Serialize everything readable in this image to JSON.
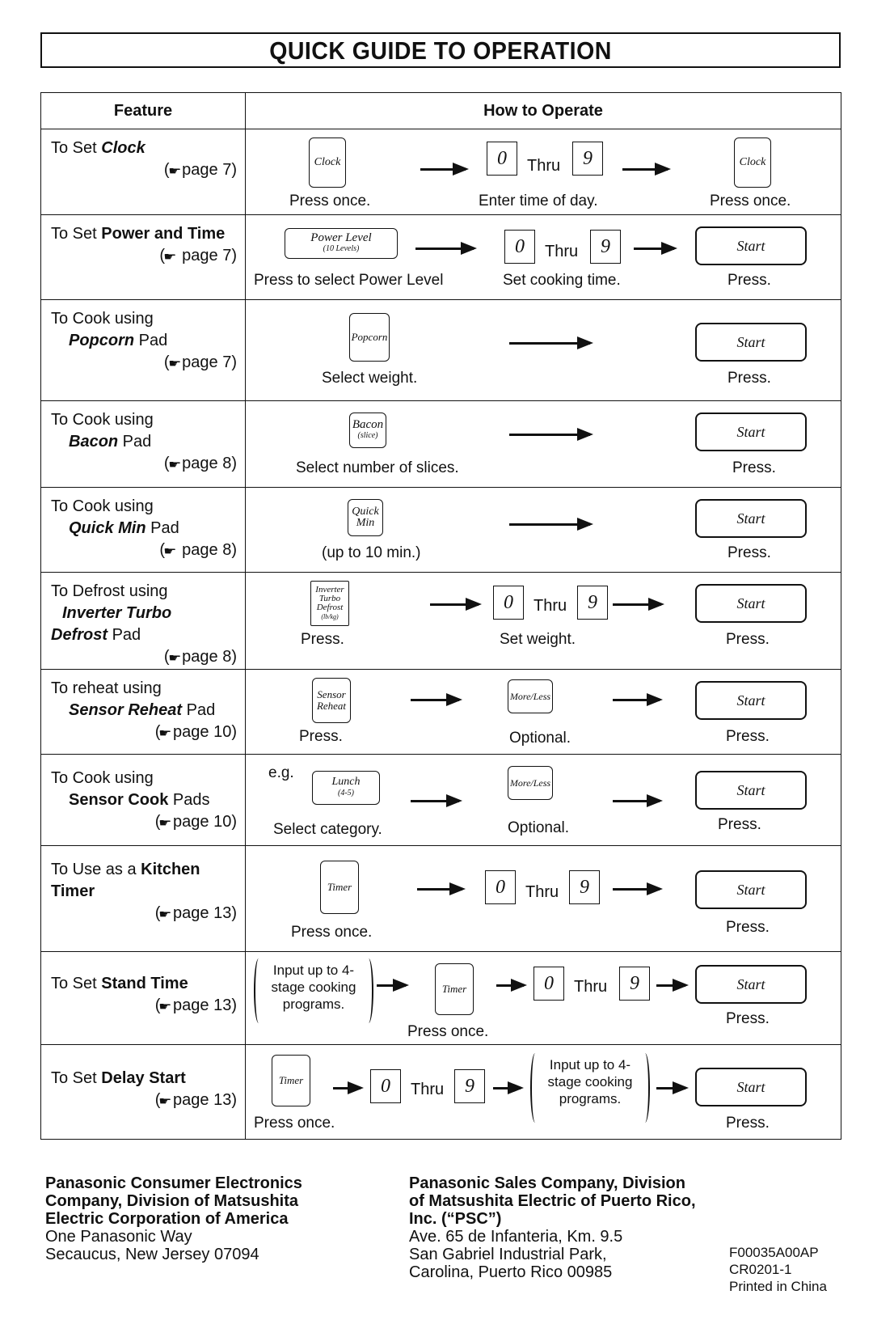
{
  "title": "QUICK GUIDE TO OPERATION",
  "headers": {
    "feature": "Feature",
    "how": "How to Operate"
  },
  "rows": [
    {
      "feature_pre": "To Set ",
      "feature_em": "Clock",
      "ref": "page 7",
      "pad1": "Clock",
      "lbl1": "Press once.",
      "digit0": "0",
      "thru": "Thru",
      "digit9": "9",
      "lbl2": "Enter time of day.",
      "pad2": "Clock",
      "lbl3": "Press once."
    },
    {
      "feature_pre": "To Set ",
      "feature_b": "Power and Time",
      "ref": "page 7",
      "pad1": "Power Level",
      "pad1_sub": "(10 Levels)",
      "lbl1": "Press to select Power Level",
      "digit0": "0",
      "thru": "Thru",
      "digit9": "9",
      "lbl2": "Set cooking time.",
      "start": "Start",
      "lbl3": "Press."
    },
    {
      "feature_pre": "To Cook using",
      "feature_em": "Popcorn",
      "feature_post": " Pad",
      "ref": "page 7",
      "pad1": "Popcorn",
      "lbl1": "Select weight.",
      "start": "Start",
      "lbl3": "Press."
    },
    {
      "feature_pre": "To Cook using",
      "feature_em": "Bacon",
      "feature_post": " Pad",
      "ref": "page 8",
      "pad1": "Bacon",
      "pad1_sub": "(slice)",
      "lbl1": "Select number of slices.",
      "start": "Start",
      "lbl3": "Press."
    },
    {
      "feature_pre": "To Cook using",
      "feature_em": "Quick Min",
      "feature_post": " Pad",
      "ref": "page 8",
      "pad1": "Quick Min",
      "lbl1": "(up to 10 min.)",
      "start": "Start",
      "lbl3": "Press."
    },
    {
      "feature_pre": "To Defrost using",
      "feature_em": "Inverter Turbo",
      "feature_em2": "Defrost",
      "feature_post": " Pad",
      "ref": "page 8",
      "pad1": "Inverter Turbo Defrost",
      "pad1_sub": "(lb/kg)",
      "lbl1": "Press.",
      "digit0": "0",
      "thru": "Thru",
      "digit9": "9",
      "lbl2": "Set weight.",
      "start": "Start",
      "lbl3": "Press."
    },
    {
      "feature_pre": "To reheat using",
      "feature_em": "Sensor Reheat",
      "feature_post": " Pad",
      "ref": "page 10",
      "pad1": "Sensor Reheat",
      "lbl1": "Press.",
      "pad2": "More/Less",
      "lbl2": "Optional.",
      "start": "Start",
      "lbl3": "Press."
    },
    {
      "feature_pre": "To Cook using",
      "feature_b": "Sensor Cook",
      "feature_post": " Pads",
      "ref": "page 10",
      "eg": "e.g.",
      "pad1": "Lunch",
      "pad1_sub": "(4-5)",
      "lbl1": "Select category.",
      "pad2": "More/Less",
      "lbl2": "Optional.",
      "start": "Start",
      "lbl3": "Press."
    },
    {
      "feature_pre": "To Use as a ",
      "feature_b": "Kitchen Timer",
      "ref": "page 13",
      "pad1": "Timer",
      "lbl1": "Press once.",
      "digit0": "0",
      "thru": "Thru",
      "digit9": "9",
      "start": "Start",
      "lbl3": "Press."
    },
    {
      "feature_pre": "To Set ",
      "feature_b": "Stand Time",
      "ref": "page 13",
      "paren": "Input up to 4-stage cooking programs.",
      "pad1": "Timer",
      "lbl1": "Press once.",
      "digit0": "0",
      "thru": "Thru",
      "digit9": "9",
      "start": "Start",
      "lbl3": "Press."
    },
    {
      "feature_pre": "To Set ",
      "feature_b": "Delay Start",
      "ref": "page 13",
      "pad1": "Timer",
      "lbl1": "Press once.",
      "digit0": "0",
      "thru": "Thru",
      "digit9": "9",
      "paren": "Input up to 4-stage cooking programs.",
      "start": "Start",
      "lbl3": "Press."
    }
  ],
  "footer": {
    "left": {
      "bold": [
        "Panasonic Consumer Electronics",
        "Company, Division of Matsushita",
        "Electric Corporation of America"
      ],
      "lines": [
        "One Panasonic Way",
        "Secaucus, New Jersey 07094"
      ]
    },
    "right": {
      "bold": [
        "Panasonic Sales Company, Division",
        "of Matsushita Electric of Puerto Rico,",
        "Inc. (“PSC”)"
      ],
      "lines": [
        "Ave. 65 de Infanteria, Km. 9.5",
        "San Gabriel Industrial Park,",
        "Carolina, Puerto Rico 00985"
      ]
    },
    "codes": [
      "F00035A00AP",
      "CR0201-1",
      "Printed in China"
    ]
  }
}
